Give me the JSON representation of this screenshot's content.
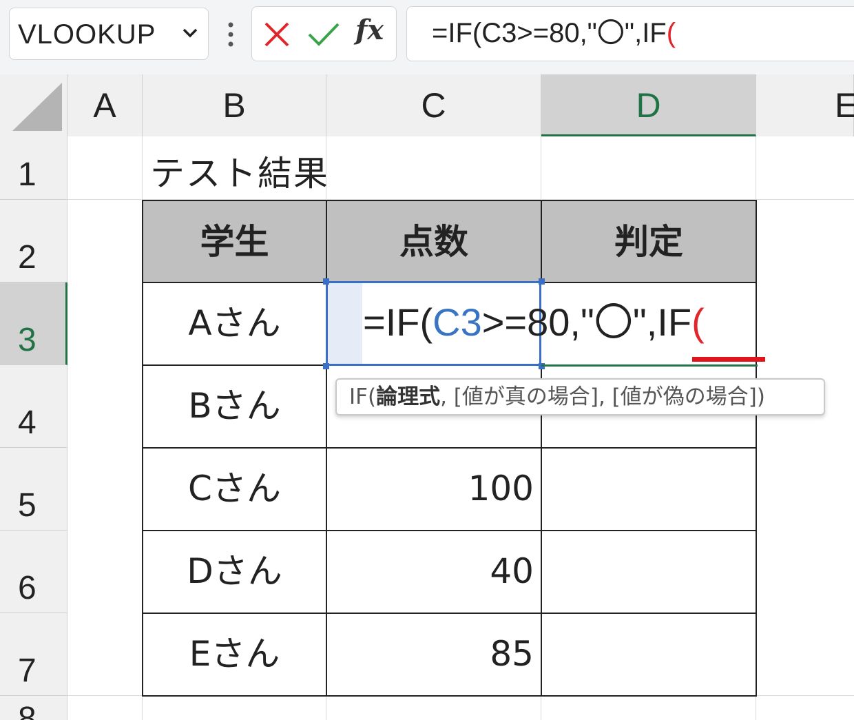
{
  "formula_bar": {
    "name_box": "VLOOKUP",
    "formula_prefix": "=IF(C3>=80,\"〇\",IF",
    "formula_paren": "(",
    "fx_label": "fx"
  },
  "columns": [
    "A",
    "B",
    "C",
    "D",
    "E"
  ],
  "rows": [
    "1",
    "2",
    "3",
    "4",
    "5",
    "6",
    "7",
    "8"
  ],
  "sheet": {
    "title": "テスト結果",
    "headers": [
      "学生",
      "点数",
      "判定"
    ],
    "students": [
      "Aさん",
      "Bさん",
      "Cさん",
      "Dさん",
      "Eさん"
    ],
    "scores": [
      "",
      "",
      "100",
      "40",
      "85"
    ]
  },
  "editor": {
    "part1": "=IF(",
    "ref": "C3",
    "part2": ">=80,\"〇\",IF",
    "paren": "("
  },
  "tooltip": {
    "func": "IF(",
    "arg_bold": "論理式",
    "rest": ", [値が真の場合], [値が偽の場合])"
  },
  "colors": {
    "selection_blue": "#3a6fc7",
    "excel_green": "#217346",
    "error_red": "#e1262b",
    "header_fill": "#c0c0c0"
  }
}
